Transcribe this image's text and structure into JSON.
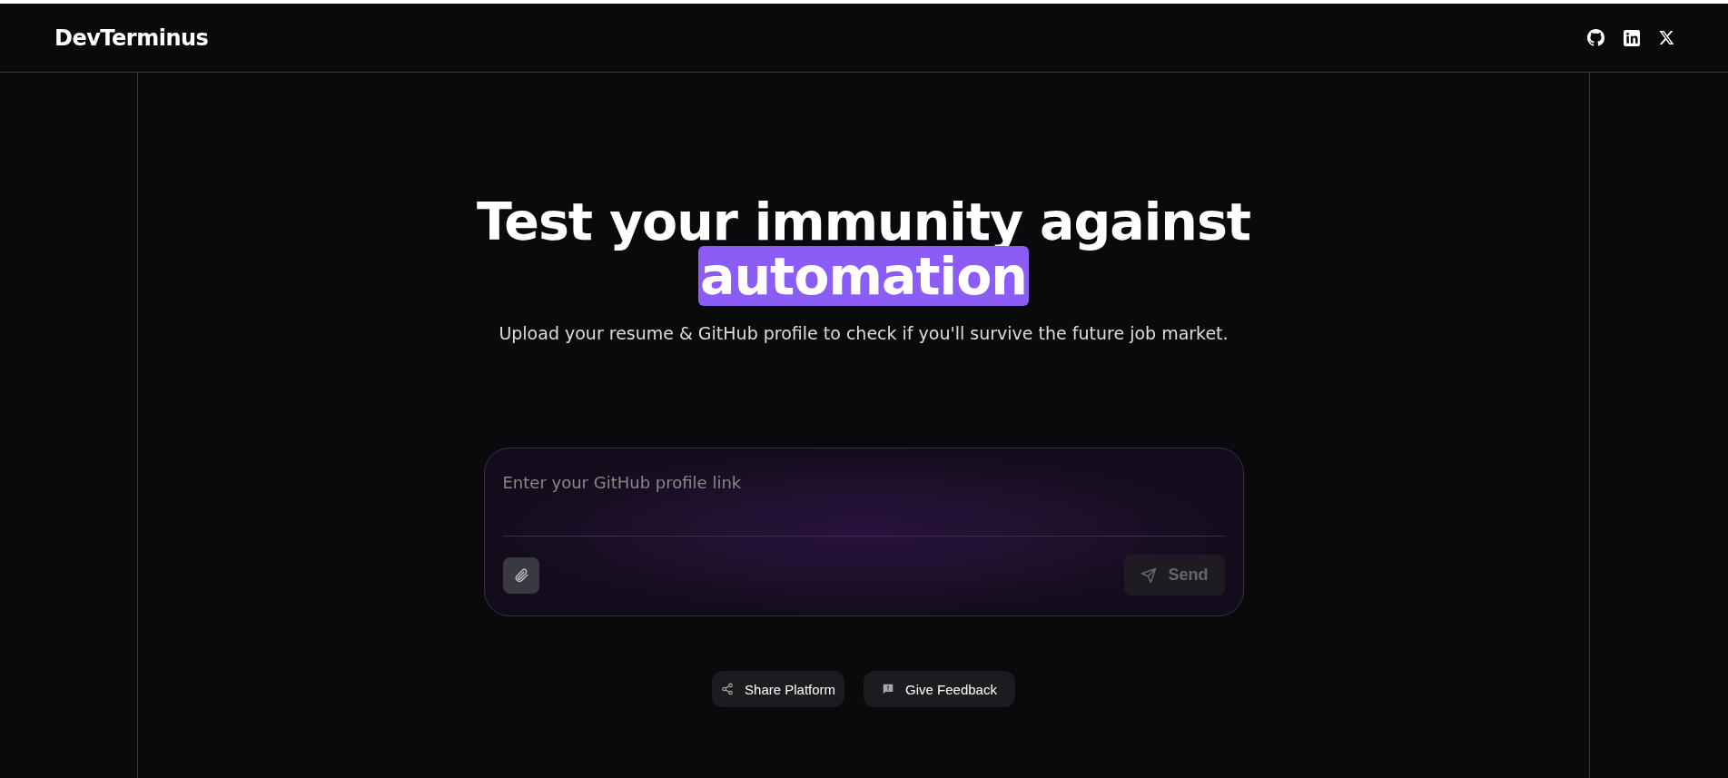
{
  "header": {
    "logo": "DevTerminus",
    "social": [
      {
        "kind": "github"
      },
      {
        "kind": "linkedin"
      },
      {
        "kind": "x"
      }
    ]
  },
  "hero": {
    "title": "Test your immunity against",
    "highlight": "automation",
    "subtitle": "Upload your resume & GitHub profile to check if you'll survive the future job market."
  },
  "prompt": {
    "placeholder": "Enter your GitHub profile link",
    "send": {
      "label": "Send",
      "disabled": true
    }
  },
  "actions": [
    {
      "kind": "share",
      "label": "Share Platform"
    },
    {
      "kind": "feedback",
      "label": "Give Feedback"
    }
  ]
}
